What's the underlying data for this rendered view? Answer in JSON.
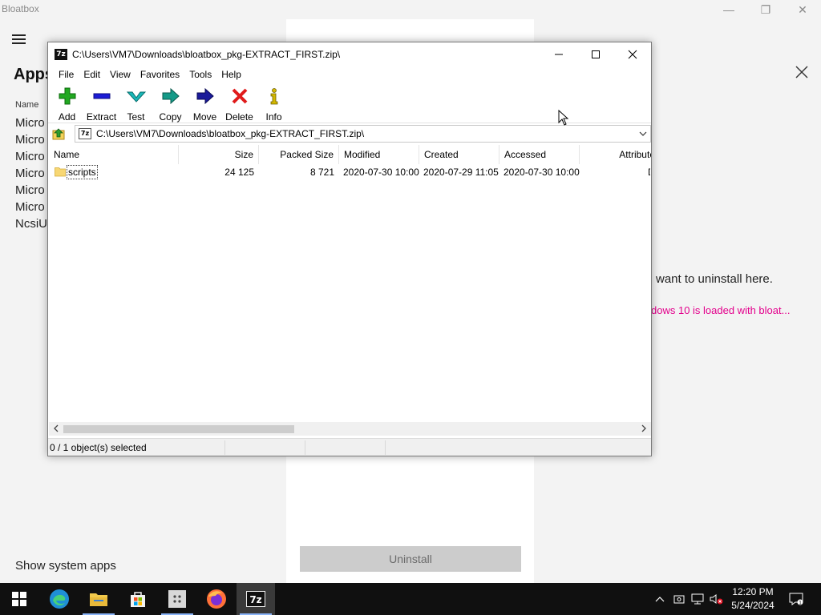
{
  "bloatbox": {
    "window_title": "Bloatbox",
    "min_glyph": "—",
    "restore_glyph": "❐",
    "close_glyph": "✕",
    "apps_heading": "Apps",
    "name_header": "Name",
    "app_list": [
      "Micro",
      "Micro",
      "Micro",
      "Micro",
      "Micro",
      "Micro",
      "NcsiU"
    ],
    "show_system_apps": "Show system apps",
    "uninstall_label": "Uninstall",
    "uninstall_hint": "want to uninstall here.",
    "info_link": "dows 10 is loaded with bloat..."
  },
  "sevenzip": {
    "app_icon_text": "7z",
    "title": "C:\\Users\\VM7\\Downloads\\bloatbox_pkg-EXTRACT_FIRST.zip\\",
    "menu": [
      "File",
      "Edit",
      "View",
      "Favorites",
      "Tools",
      "Help"
    ],
    "toolbar": [
      {
        "label": "Add",
        "icon": "add-icon",
        "color": "#1a9e1a"
      },
      {
        "label": "Extract",
        "icon": "extract-icon",
        "color": "#1c1cd6"
      },
      {
        "label": "Test",
        "icon": "test-icon",
        "color": "#19b0b0"
      },
      {
        "label": "Copy",
        "icon": "copy-icon",
        "color": "#138a7a"
      },
      {
        "label": "Move",
        "icon": "move-icon",
        "color": "#1a1a9a"
      },
      {
        "label": "Delete",
        "icon": "delete-icon",
        "color": "#e01b1b"
      },
      {
        "label": "Info",
        "icon": "info-icon",
        "color": "#d4b800"
      }
    ],
    "address": "C:\\Users\\VM7\\Downloads\\bloatbox_pkg-EXTRACT_FIRST.zip\\",
    "columns": [
      "Name",
      "Size",
      "Packed Size",
      "Modified",
      "Created",
      "Accessed",
      "Attribute"
    ],
    "rows": [
      {
        "name": "scripts",
        "size": "24 125",
        "packed_size": "8 721",
        "modified": "2020-07-30 10:00",
        "created": "2020-07-29 11:05",
        "accessed": "2020-07-30 10:00",
        "attributes": "D"
      }
    ],
    "status": "0 / 1 object(s) selected"
  },
  "taskbar": {
    "apps": [
      "start",
      "edge",
      "file-explorer",
      "microsoft-store",
      "bloatbox",
      "firefox",
      "7-zip"
    ],
    "time": "12:20 PM",
    "date": "5/24/2024"
  }
}
